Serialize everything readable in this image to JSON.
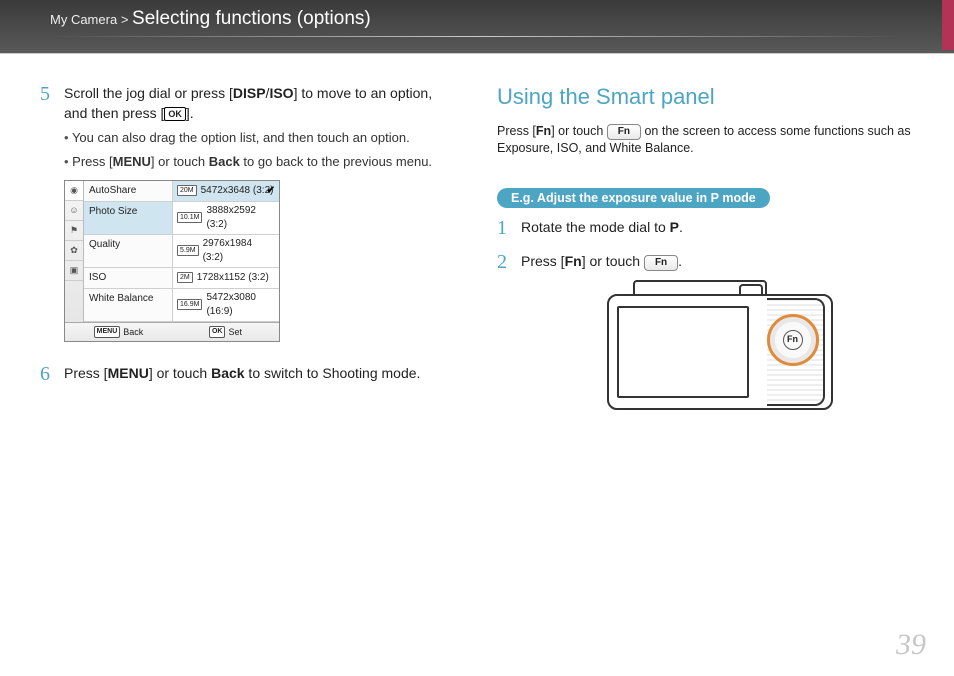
{
  "header": {
    "category": "My Camera",
    "section": "Selecting functions (options)"
  },
  "left": {
    "step5": {
      "num": "5",
      "text_a": "Scroll the jog dial or press [",
      "disp": "DISP",
      "sep": "/",
      "iso": "ISO",
      "text_b": "] to move to an option, and then press [",
      "ok": "OK",
      "text_c": "].",
      "bullet1_a": "You can also drag the option list, and then touch an option.",
      "bullet2_a": "Press [",
      "menu": "MENU",
      "bullet2_b": "] or touch ",
      "back": "Back",
      "bullet2_c": " to go back to the previous menu."
    },
    "menu": {
      "items": [
        "AutoShare",
        "Photo Size",
        "Quality",
        "ISO",
        "White Balance"
      ],
      "selectedLeft": 1,
      "opts": [
        {
          "badge": "20M",
          "label": "5472x3648 (3:2)",
          "sel": true,
          "chk": true
        },
        {
          "badge": "10.1M",
          "label": "3888x2592 (3:2)"
        },
        {
          "badge": "5.9M",
          "label": "2976x1984 (3:2)"
        },
        {
          "badge": "2M",
          "label": "1728x1152 (3:2)"
        },
        {
          "badge": "16.9M",
          "label": "5472x3080 (16:9)"
        }
      ],
      "footerBackTag": "MENU",
      "footerBack": "Back",
      "footerSetTag": "OK",
      "footerSet": "Set"
    },
    "step6": {
      "num": "6",
      "a": "Press [",
      "menu": "MENU",
      "b": "] or touch ",
      "back": "Back",
      "c": " to switch to Shooting mode."
    }
  },
  "right": {
    "heading": "Using the Smart panel",
    "p_a": "Press [",
    "fn": "Fn",
    "p_b": "] or touch ",
    "fnpill": "Fn",
    "p_c": " on the screen to access some functions such as Exposure, ISO, and White Balance.",
    "eg_a": "E.g. Adjust the exposure value in ",
    "eg_p": "P",
    "eg_b": " mode",
    "step1": {
      "num": "1",
      "a": "Rotate the mode dial to ",
      "p": "P",
      "b": "."
    },
    "step2": {
      "num": "2",
      "a": "Press [",
      "fn": "Fn",
      "b": "] or touch ",
      "pill": "Fn",
      "c": "."
    },
    "camera_fn": "Fn"
  },
  "pagenum": "39"
}
